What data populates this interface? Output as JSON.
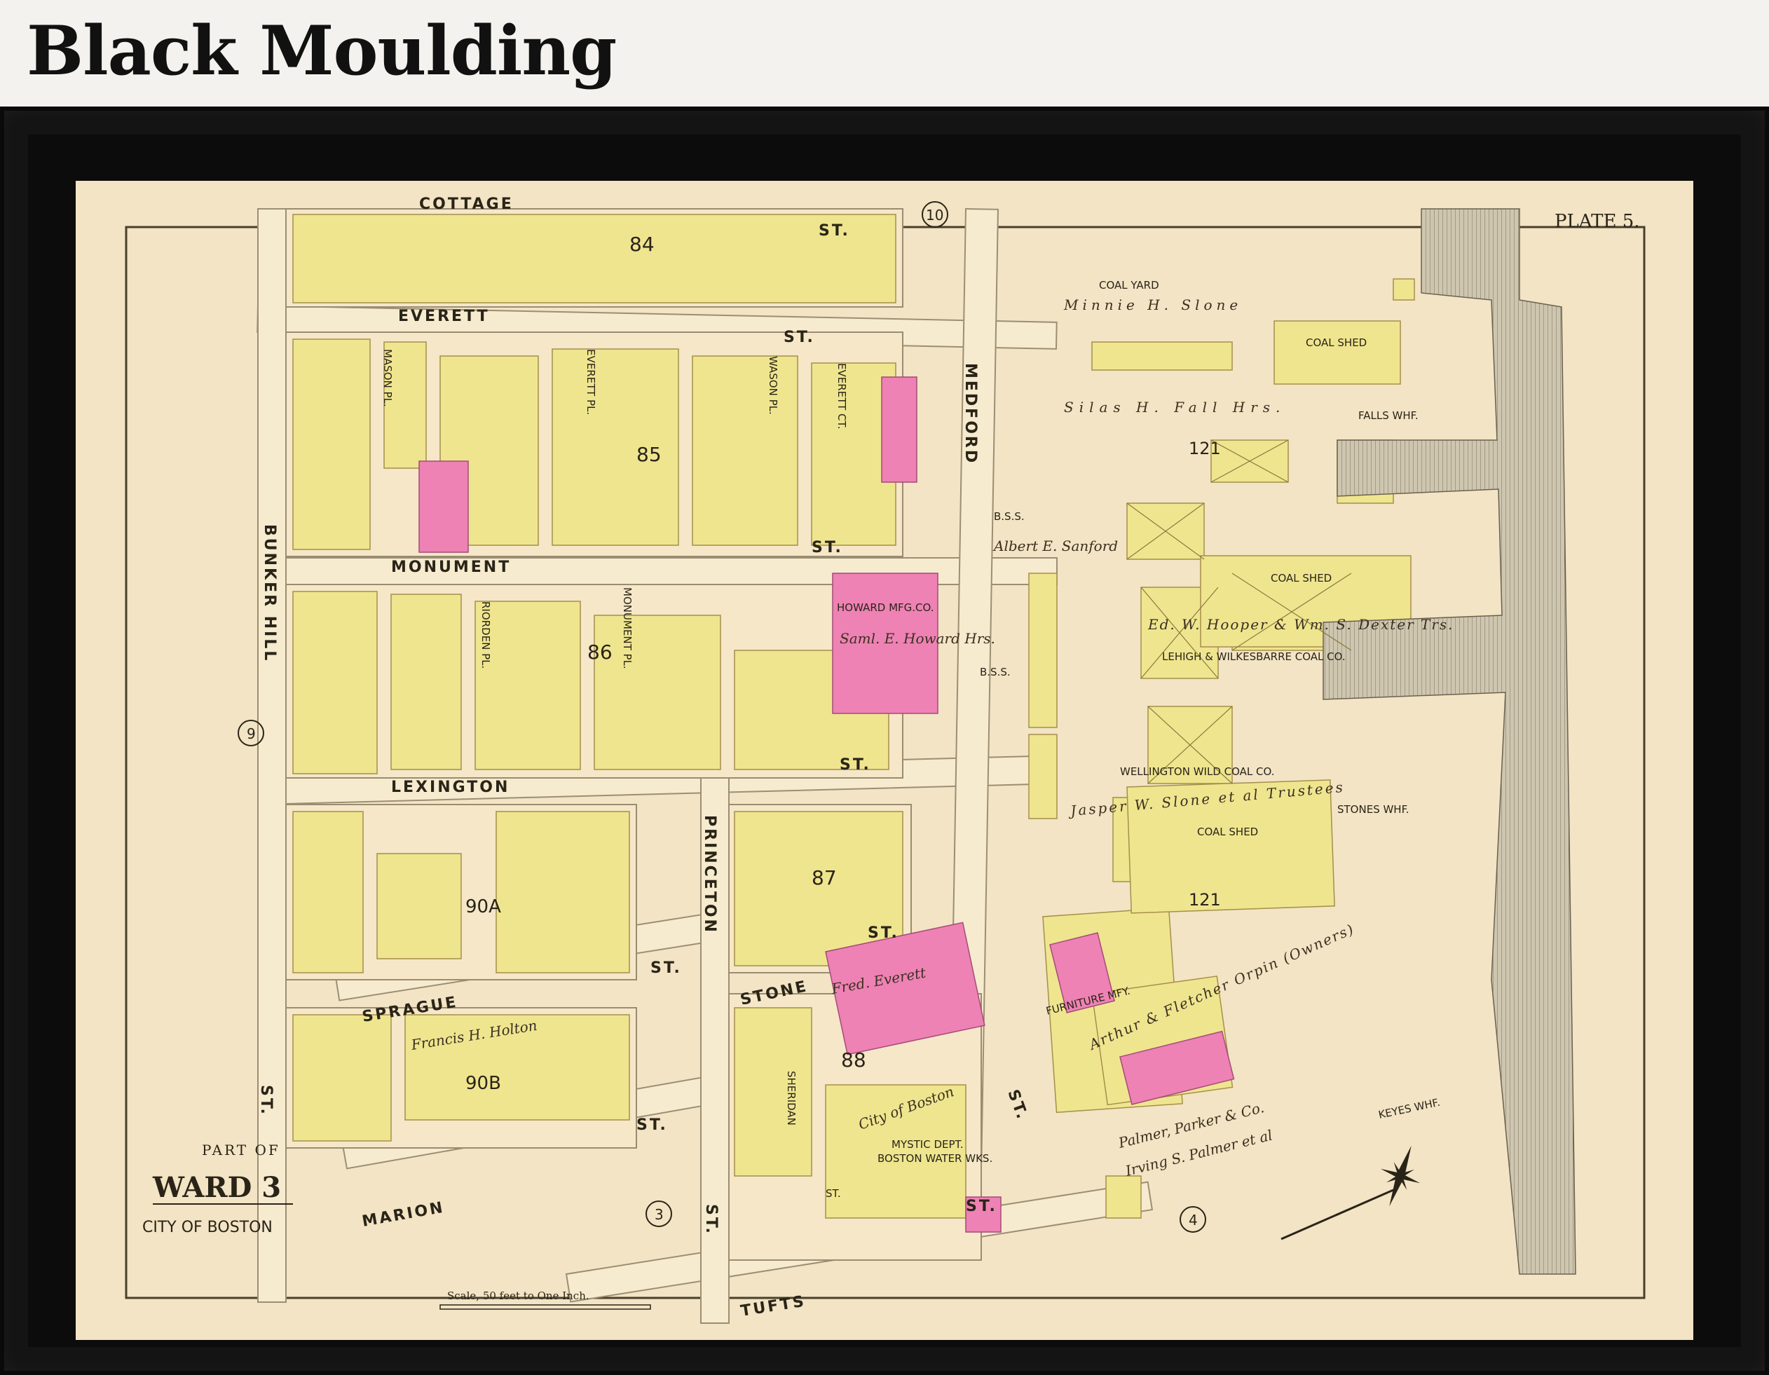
{
  "page": {
    "title": "Black Moulding"
  },
  "map": {
    "plate": "PLATE 5.",
    "ward": {
      "part_of": "PART OF",
      "ward": "WARD 3",
      "city": "CITY OF BOSTON"
    },
    "scale": "Scale, 50 feet to One Inch.",
    "streets": {
      "cottage": "COTTAGE",
      "everett": "EVERETT",
      "monument": "MONUMENT",
      "lexington": "LEXINGTON",
      "sprague": "SPRAGUE",
      "marion": "MARION",
      "tufts": "TUFTS",
      "stone": "STONE",
      "bunker_hill": "BUNKER HILL",
      "medford": "MEDFORD",
      "princeton": "PRINCETON",
      "riorden_pl": "RIORDEN PL.",
      "monument_pl": "MONUMENT PL.",
      "everett_pl": "EVERETT PL.",
      "everett_ct": "EVERETT CT.",
      "mason_pl": "MASON PL.",
      "wason_pl": "WASON PL.",
      "sheridan": "SHERIDAN",
      "st": "ST."
    },
    "block_numbers": [
      "84",
      "85",
      "86",
      "87",
      "88",
      "90A",
      "90B",
      "121",
      "121"
    ],
    "ward_circles": [
      "10",
      "9",
      "3",
      "4"
    ],
    "labels": {
      "coal_yard": "COAL YARD",
      "coal_shed": "COAL SHED",
      "falls_whf": "FALLS WHF.",
      "stones_whf": "STONES WHF.",
      "keyes_whf": "KEYES WHF.",
      "howard_mfg": "HOWARD MFG.CO.",
      "lehigh": "LEHIGH & WILKESBARRE COAL CO.",
      "wellington": "WELLINGTON WILD COAL CO.",
      "furniture": "FURNITURE MFY.",
      "mystic": "MYSTIC DEPT.",
      "water_wks": "BOSTON WATER WKS.",
      "bss": "B.S.S."
    },
    "owners": {
      "minnie": "Minnie H. Slone",
      "silas": "Silas H. Fall Hrs.",
      "albert": "Albert E. Sanford",
      "hooper": "Ed. W. Hooper & Wm. S. Dexter Trs.",
      "jasper": "Jasper W. Slone et al Trustees",
      "orpin": "Arthur & Fletcher Orpin (Owners)",
      "palmer": "Palmer, Parker & Co.",
      "irving": "Irving S. Palmer et al",
      "howard": "Saml. E. Howard Hrs.",
      "everett": "Fred. Everett",
      "city": "City of Boston",
      "francis": "Francis H. Holton"
    },
    "colors": {
      "paper": "#f2e4c4",
      "parcel_yellow": "#efe58f",
      "parcel_pink": "#ee82b4",
      "road": "#f6ebcf",
      "ink": "#2a2418",
      "frame": "#141414"
    }
  }
}
